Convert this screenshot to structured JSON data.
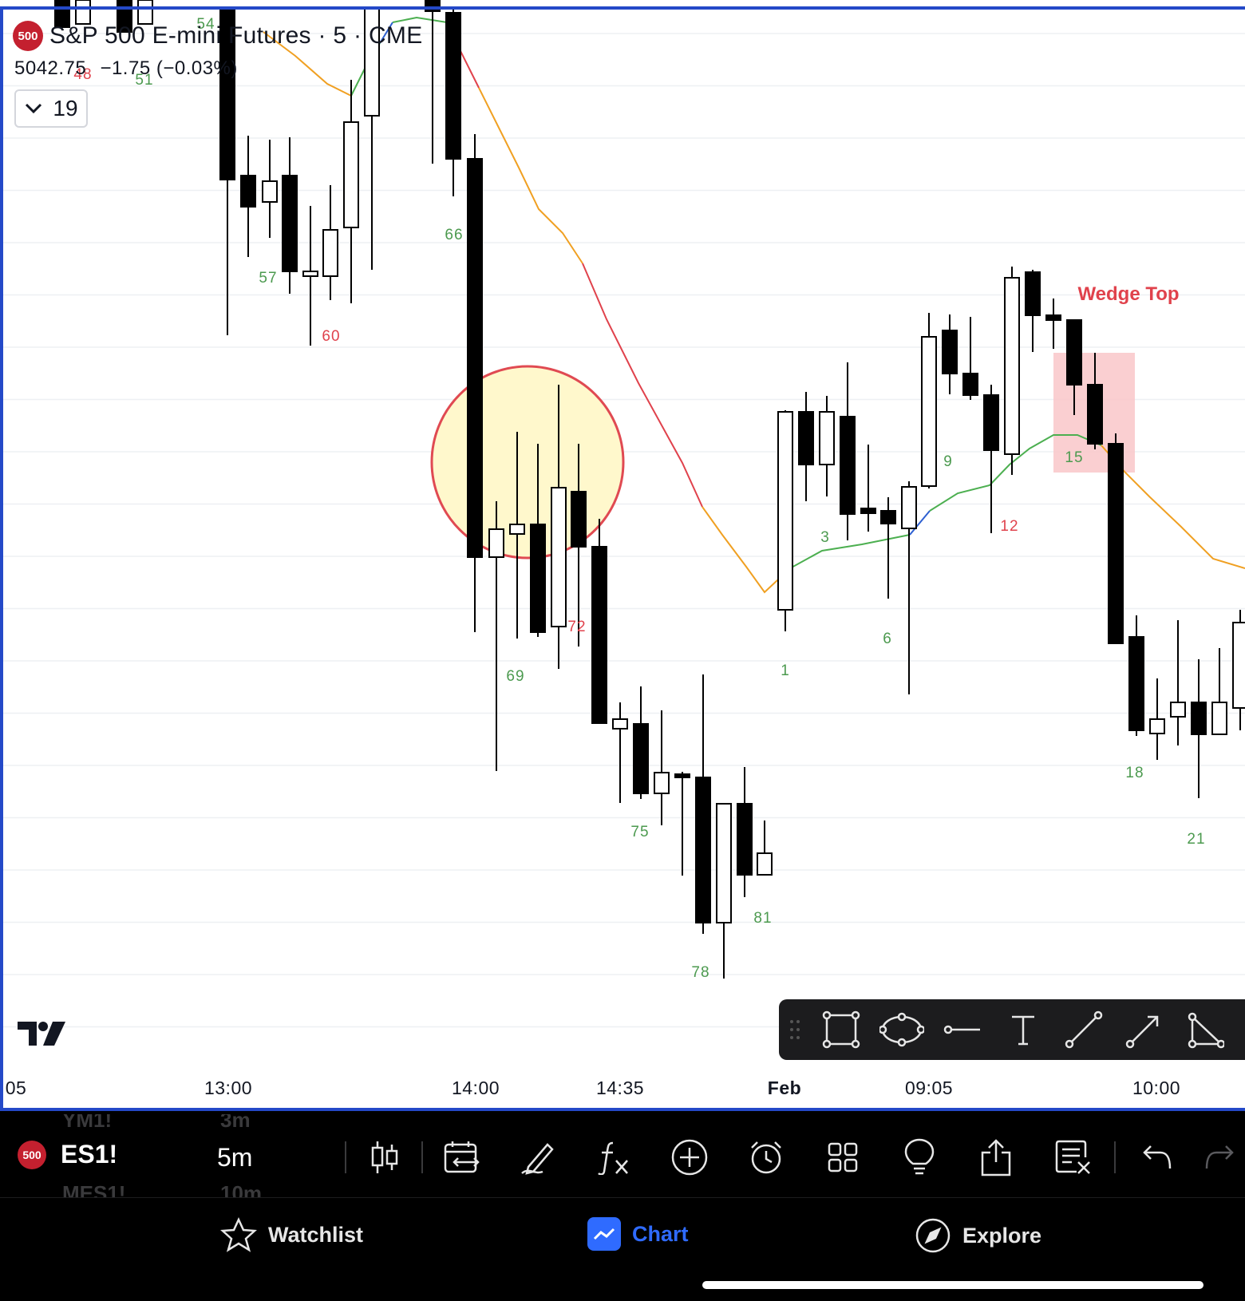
{
  "header": {
    "symbol_badge": "500",
    "title": "S&P 500 E-mini Futures · 5 · CME",
    "last_price": "5042.75",
    "change": "−1.75 (−0.03%)",
    "collapsed_count": "19"
  },
  "colors": {
    "accent": "#2f6bff",
    "bull_label": "#4c9a4f",
    "bear_label": "#e0424c",
    "ema_above": "#f0a022",
    "ema_bull": "#4caf50",
    "ema_bear": "#e0424c",
    "ema_neutral": "#2d5fd0"
  },
  "chart_data": {
    "type": "candlestick",
    "symbol": "ES1!",
    "interval": "5m",
    "x_ticks": [
      "05",
      "13:00",
      "14:00",
      "14:35",
      "Feb",
      "09:05",
      "10:00"
    ],
    "annotations": [
      {
        "type": "circle",
        "color": "#fff8cc",
        "border": "#e04a52"
      },
      {
        "type": "rect",
        "color": "#f9c7c9",
        "label": "Wedge Top",
        "label_color": "#e0424c"
      }
    ],
    "bar_labels": [
      {
        "text": "48",
        "color": "red"
      },
      {
        "text": "51",
        "color": "green"
      },
      {
        "text": "54",
        "color": "green"
      },
      {
        "text": "57",
        "color": "green"
      },
      {
        "text": "60",
        "color": "red"
      },
      {
        "text": "66",
        "color": "green"
      },
      {
        "text": "69",
        "color": "green"
      },
      {
        "text": "72",
        "color": "red"
      },
      {
        "text": "75",
        "color": "green"
      },
      {
        "text": "78",
        "color": "green"
      },
      {
        "text": "81",
        "color": "green"
      },
      {
        "text": "1",
        "color": "green"
      },
      {
        "text": "3",
        "color": "green"
      },
      {
        "text": "6",
        "color": "green"
      },
      {
        "text": "9",
        "color": "green"
      },
      {
        "text": "12",
        "color": "red"
      },
      {
        "text": "15",
        "color": "green"
      },
      {
        "text": "18",
        "color": "green"
      },
      {
        "text": "21",
        "color": "green"
      }
    ]
  },
  "drawing_tools": [
    "rectangle-tool",
    "ellipse-tool",
    "horizontal-line-tool",
    "text-tool",
    "trend-line-tool",
    "arrow-tool",
    "triangle-tool"
  ],
  "bottom_toolbar": {
    "symbol_badge": "500",
    "symbol": "ES1!",
    "interval": "5m",
    "ghost_symbols": [
      "YM1!",
      "MES1!"
    ],
    "ghost_intervals": [
      "3m",
      "10m"
    ]
  },
  "tabs": [
    {
      "label": "Watchlist",
      "icon": "star-icon"
    },
    {
      "label": "Chart",
      "icon": "chart-icon"
    },
    {
      "label": "Explore",
      "icon": "compass-icon"
    }
  ]
}
